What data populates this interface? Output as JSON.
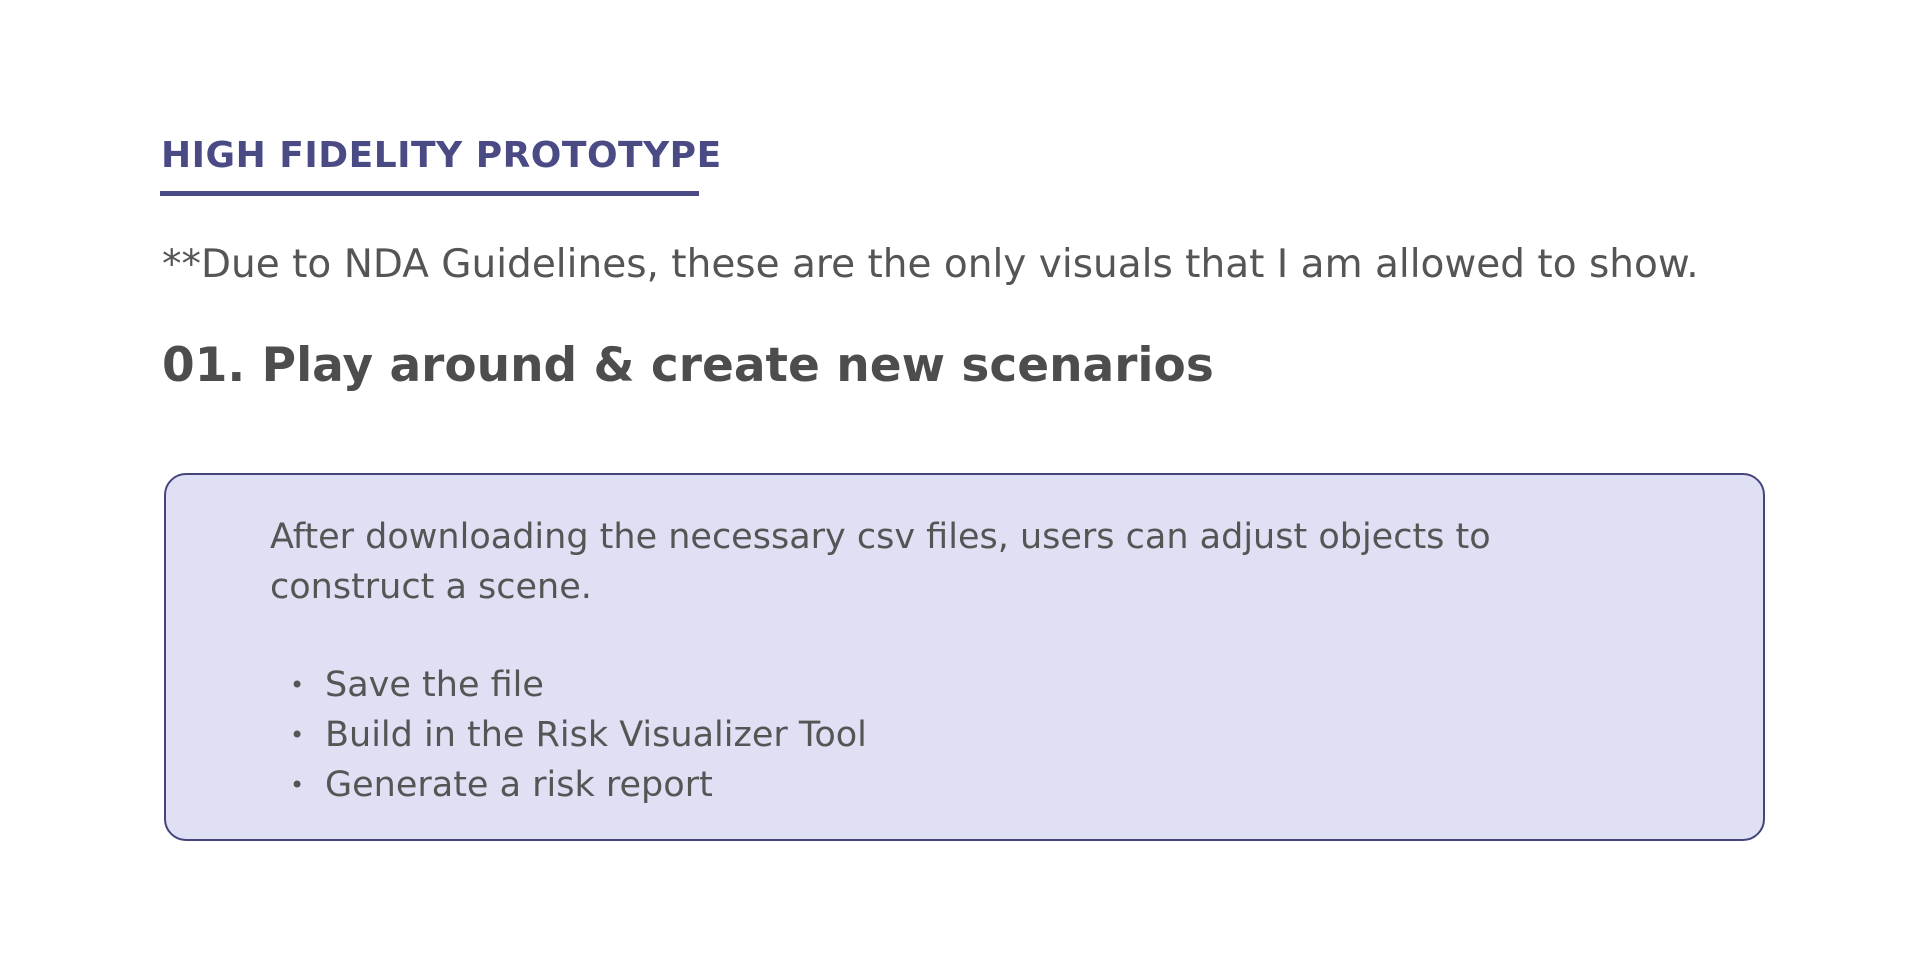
{
  "section": {
    "label": "HIGH FIDELITY PROTOTYPE"
  },
  "disclaimer": "**Due to NDA Guidelines, these are the only visuals that I am allowed to show.",
  "step": {
    "heading": "01. Play around & create new scenarios"
  },
  "callout": {
    "text": "After downloading the necessary csv files, users can adjust objects to construct a scene.",
    "items": [
      {
        "label": "Save the file"
      },
      {
        "label": "Build in the Risk Visualizer Tool"
      },
      {
        "label": "Generate a risk report"
      }
    ],
    "bullet": "•"
  },
  "colors": {
    "accent": "#4a4a85",
    "callout_background": "#e0e0f4",
    "callout_border": "#45457e",
    "text": "#555555"
  }
}
